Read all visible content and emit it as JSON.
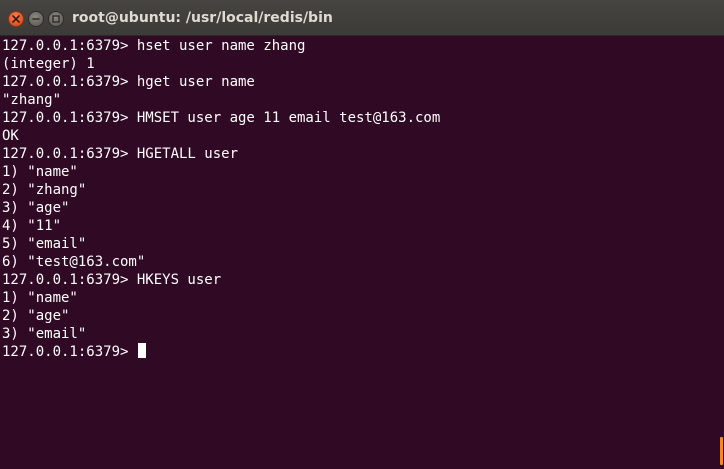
{
  "window": {
    "title": "root@ubuntu: /usr/local/redis/bin"
  },
  "terminal": {
    "prompt": "127.0.0.1:6379>",
    "lines": [
      "127.0.0.1:6379> hset user name zhang",
      "(integer) 1",
      "127.0.0.1:6379> hget user name",
      "\"zhang\"",
      "127.0.0.1:6379> HMSET user age 11 email test@163.com",
      "OK",
      "127.0.0.1:6379> HGETALL user",
      "1) \"name\"",
      "2) \"zhang\"",
      "3) \"age\"",
      "4) \"11\"",
      "5) \"email\"",
      "6) \"test@163.com\"",
      "127.0.0.1:6379> HKEYS user",
      "1) \"name\"",
      "2) \"age\"",
      "3) \"email\""
    ],
    "current_prompt": "127.0.0.1:6379> "
  },
  "colors": {
    "background": "#300a24",
    "text": "#ffffff",
    "titlebar": "#3c3b37",
    "close_button": "#e2592a",
    "scroll_accent": "#f5891f"
  }
}
